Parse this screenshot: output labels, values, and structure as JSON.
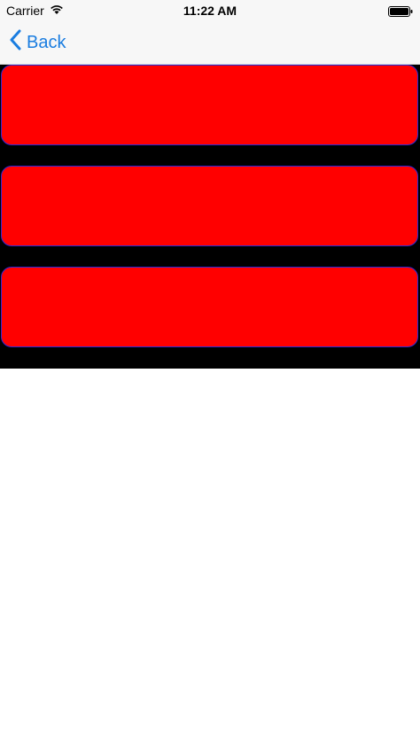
{
  "status_bar": {
    "carrier": "Carrier",
    "time": "11:22 AM",
    "wifi_icon": "wifi-icon",
    "battery_icon": "battery-icon"
  },
  "nav_bar": {
    "back_label": "Back",
    "back_icon": "chevron-left-icon",
    "accent_color": "#1a7de0"
  },
  "content": {
    "background_color": "#000000",
    "cards": [
      {
        "color": "#ff0000"
      },
      {
        "color": "#ff0000"
      },
      {
        "color": "#ff0000"
      }
    ]
  }
}
